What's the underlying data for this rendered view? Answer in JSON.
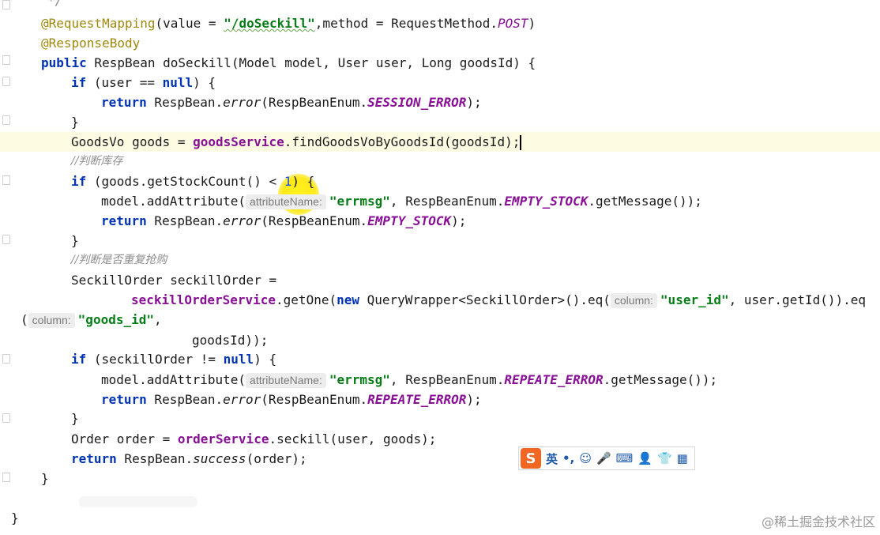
{
  "editor": {
    "l0": "*/",
    "l1": {
      "ann": "@RequestMapping",
      "p1": "(value = ",
      "str": "\"/doSeckill\"",
      "p2": ",method = RequestMethod.",
      "const": "POST",
      "p3": ")"
    },
    "l2": "@ResponseBody",
    "l3": {
      "kw": "public",
      "rest": " RespBean doSeckill(Model model, User user, Long goodsId) {"
    },
    "l4": {
      "kw1": "if",
      "p1": " (user == ",
      "kw2": "null",
      "p2": ") {"
    },
    "l5": {
      "kw": "return",
      "p1": " RespBean.",
      "it": "error",
      "p2": "(RespBeanEnum.",
      "const": "SESSION_ERROR",
      "p3": ");"
    },
    "l6": "}",
    "l7": {
      "p1": "GoodsVo goods = ",
      "field": "goodsService",
      "p2": ".findGoodsVoByGoodsId(goodsId);"
    },
    "l8": "//判断库存",
    "l9": {
      "kw": "if",
      "p1": " (goods.getStockCount() < ",
      "num": "1",
      "p2": ") {"
    },
    "l10": {
      "p1": "model.addAttribute(",
      "hint": "attributeName:",
      "str": "\"errmsg\"",
      "p2": ", RespBeanEnum.",
      "const": "EMPTY_STOCK",
      "p3": ".getMessage());"
    },
    "l11": {
      "kw": "return",
      "p1": " RespBean.",
      "it": "error",
      "p2": "(RespBeanEnum.",
      "const": "EMPTY_STOCK",
      "p3": ");"
    },
    "l12": "}",
    "l13": "//判断是否重复抢购",
    "l14": "SeckillOrder seckillOrder =",
    "l15": {
      "field": "seckillOrderService",
      "p1": ".getOne(",
      "kw": "new",
      "p2": " QueryWrapper<SeckillOrder>().eq(",
      "hint": "column:",
      "str": "\"user_id\"",
      "p3": ", user.getId()).eq"
    },
    "l16": {
      "p1": "(",
      "hint": "column:",
      "str": "\"goods_id\"",
      "p2": ","
    },
    "l17": "goodsId));",
    "l18": {
      "kw1": "if",
      "p1": " (seckillOrder != ",
      "kw2": "null",
      "p2": ") {"
    },
    "l19": {
      "p1": "model.addAttribute(",
      "hint": "attributeName:",
      "str": "\"errmsg\"",
      "p2": ", RespBeanEnum.",
      "const": "REPEATE_ERROR",
      "p3": ".getMessage());"
    },
    "l20": {
      "kw": "return",
      "p1": " RespBean.",
      "it": "error",
      "p2": "(RespBeanEnum.",
      "const": "REPEATE_ERROR",
      "p3": ");"
    },
    "l21": "}",
    "l22": {
      "p1": "Order order = ",
      "field": "orderService",
      "p2": ".seckill(user, goods);"
    },
    "l23": {
      "kw": "return",
      "p1": " RespBean.",
      "it": "success",
      "p2": "(order);"
    },
    "l24": "}",
    "l25": "}"
  },
  "ime": {
    "logo": "S",
    "lang": "英",
    "punct": "•,",
    "emoji": "☺",
    "mic": "🎤",
    "keyboard": "⌨",
    "user": "👤",
    "shirt": "👕",
    "grid": "▦"
  },
  "watermark": "@稀土掘金技术社区",
  "colors": {
    "keyword": "#0033b3",
    "annotation": "#9e880d",
    "string": "#067d17",
    "constant": "#871094"
  }
}
